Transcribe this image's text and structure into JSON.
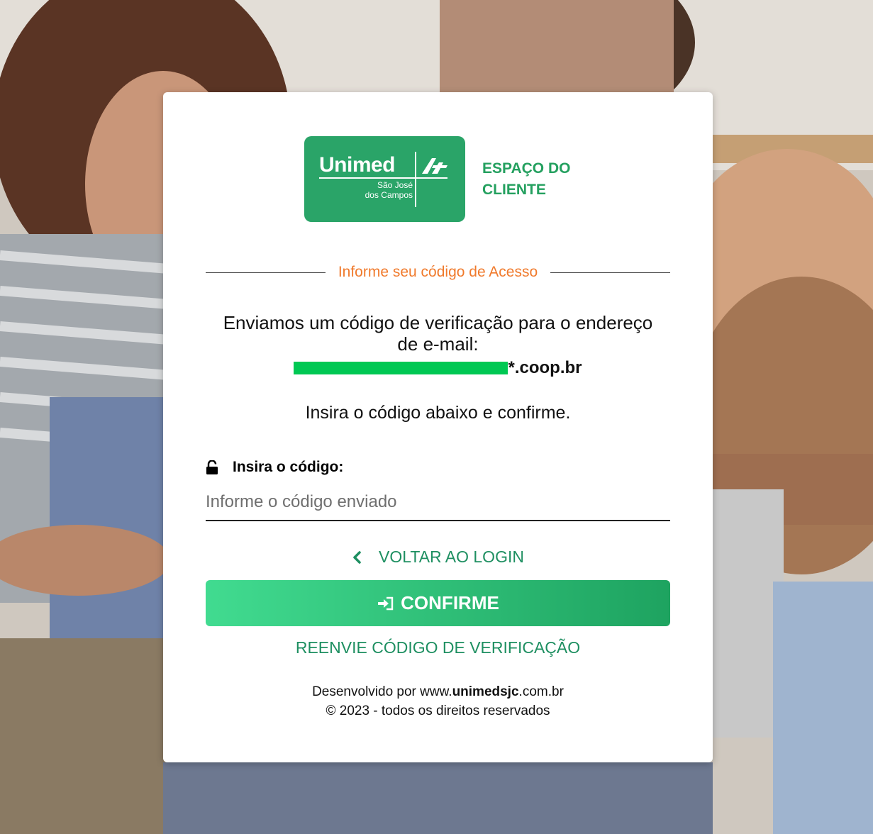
{
  "colors": {
    "brand_green": "#2aa468",
    "link_green": "#1e8f61",
    "accent_orange": "#f07a2c",
    "button_gradient_start": "#41db90",
    "button_gradient_end": "#1ea360",
    "email_mask": "#00c853"
  },
  "logo": {
    "wordmark": "Unimed",
    "sub_line1": "São José",
    "sub_line2": "dos Campos",
    "side_line1": "ESPAÇO DO",
    "side_line2": "CLIENTE",
    "mark_icon": "unimed-tree-icon"
  },
  "section_title": "Informe seu código de Acesso",
  "message": {
    "line1": "Enviamos um código de verificação para o endereço",
    "line2": "de e-mail:",
    "email_visible_part": "***********@*******",
    "email_domain": "*.coop.br"
  },
  "instruction": "Insira o código abaixo e confirme.",
  "code_field": {
    "label": "Insira o código:",
    "label_icon": "lock-open-icon",
    "placeholder": "Informe o código enviado",
    "value": ""
  },
  "back_link": {
    "icon": "chevron-left-icon",
    "label": "VOLTAR AO LOGIN"
  },
  "confirm_button": {
    "icon": "sign-in-icon",
    "label": "CONFIRME"
  },
  "resend_link": "REENVIE CÓDIGO DE VERIFICAÇÃO",
  "footer": {
    "prefix": "Desenvolvido por www.",
    "brand": "unimedsjc",
    "suffix": ".com.br",
    "copyright": "© 2023 - todos os direitos reservados"
  }
}
